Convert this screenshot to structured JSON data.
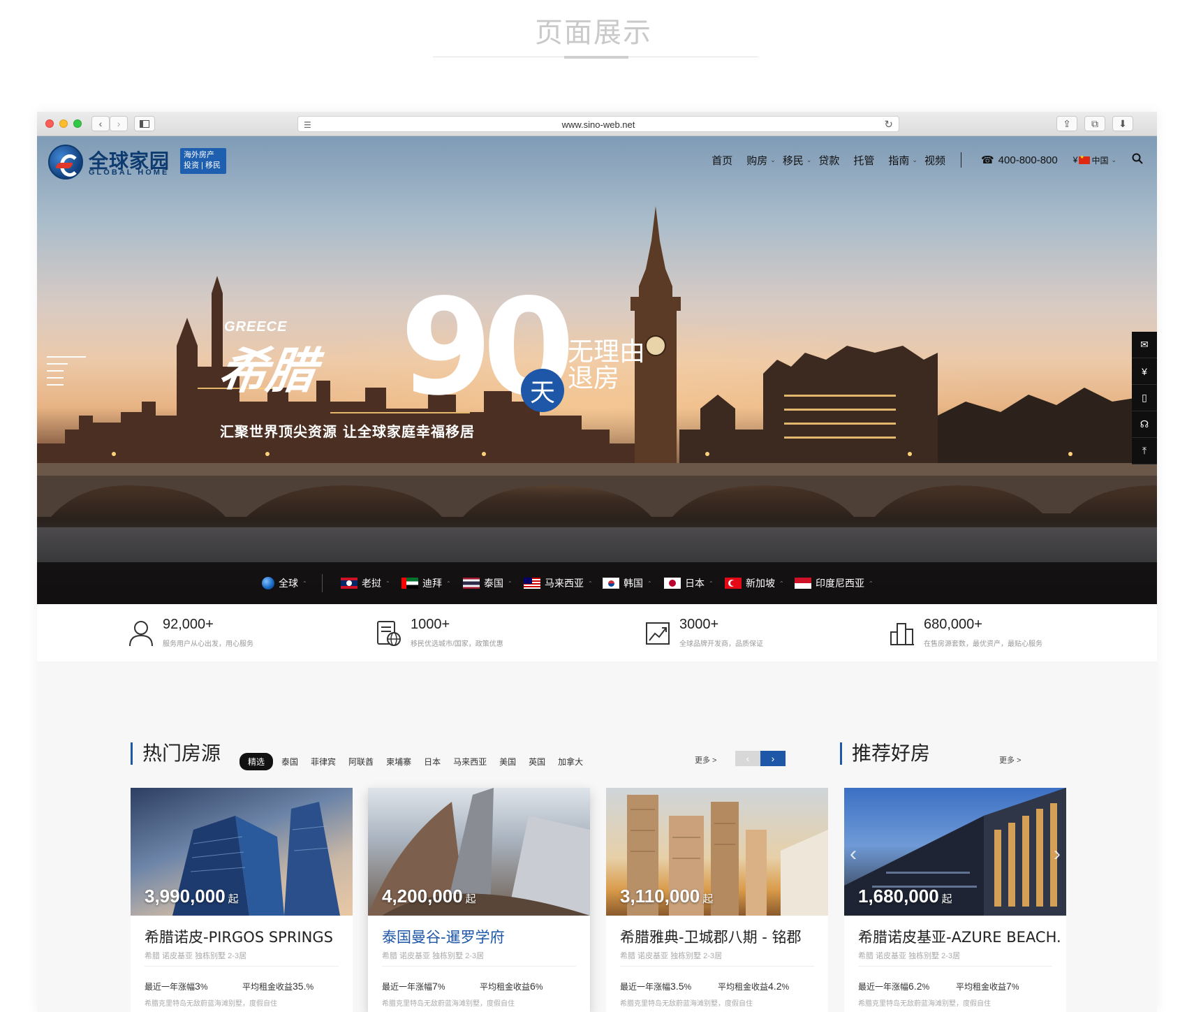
{
  "showcase": {
    "title": "页面展示"
  },
  "browser": {
    "url": "www.sino-web.net"
  },
  "logo": {
    "name_cn": "全球家园",
    "name_en": "GLOBAL HOME",
    "badge_line1": "海外房产",
    "badge_line2": "投资 | 移民"
  },
  "nav": {
    "items": [
      {
        "label": "首页",
        "dropdown": false
      },
      {
        "label": "购房",
        "dropdown": true
      },
      {
        "label": "移民",
        "dropdown": true
      },
      {
        "label": "贷款",
        "dropdown": false
      },
      {
        "label": "托管",
        "dropdown": false
      },
      {
        "label": "指南",
        "dropdown": true
      },
      {
        "label": "视频",
        "dropdown": false
      }
    ],
    "phone": "400-800-800",
    "currency": "¥",
    "region": "中国"
  },
  "promo": {
    "country_en": "GREECE",
    "country_cn": "希腊",
    "number": "90",
    "unit": "天",
    "line1": "无理由",
    "line2": "退房",
    "slogan": "汇聚世界顶尖资源  让全球家庭幸福移居"
  },
  "side_tools": [
    "wechat-icon",
    "yen-icon",
    "mobile-icon",
    "headset-icon",
    "top-icon"
  ],
  "countries": [
    {
      "label": "全球",
      "flag": "globe"
    },
    {
      "label": "老挝",
      "flag": "laos"
    },
    {
      "label": "迪拜",
      "flag": "uae"
    },
    {
      "label": "泰国",
      "flag": "thailand"
    },
    {
      "label": "马来西亚",
      "flag": "malaysia"
    },
    {
      "label": "韩国",
      "flag": "korea"
    },
    {
      "label": "日本",
      "flag": "japan"
    },
    {
      "label": "新加坡",
      "flag": "turkey-style"
    },
    {
      "label": "印度尼西亚",
      "flag": "indonesia"
    }
  ],
  "stats": [
    {
      "value": "92,000+",
      "desc": "服务用户从心出发，用心服务",
      "icon": "user-icon"
    },
    {
      "value": "1000+",
      "desc": "移民优选城市/国家，政策优惠",
      "icon": "document-globe-icon"
    },
    {
      "value": "3000+",
      "desc": "全球品牌开发商，品质保证",
      "icon": "trend-chart-icon"
    },
    {
      "value": "680,000+",
      "desc": "在售房源套数，最优资产，最贴心服务",
      "icon": "buildings-icon"
    }
  ],
  "hot": {
    "title": "热门房源",
    "tabs": [
      "精选",
      "泰国",
      "菲律宾",
      "阿联酋",
      "柬埔寨",
      "日本",
      "马来西亚",
      "美国",
      "英国",
      "加拿大"
    ],
    "more": "更多 >"
  },
  "recommend": {
    "title": "推荐好房",
    "more": "更多 >"
  },
  "cards": [
    {
      "price": "3,990,000",
      "unit": "起",
      "title": "希腊诺皮-PIRGOS SPRINGS",
      "sub": "希腊 诺皮基亚 独栋别墅 2-3居",
      "growth_label": "最近一年涨幅",
      "growth": "3",
      "rent_label": "平均租金收益",
      "rent": "35.",
      "foot": "希腊克里特岛无敌蔚蓝海滩别墅，度假自住"
    },
    {
      "price": "4,200,000",
      "unit": "起",
      "title": "泰国曼谷-暹罗学府",
      "sub": "希腊 诺皮基亚 独栋别墅 2-3居",
      "growth_label": "最近一年涨幅",
      "growth": "7",
      "rent_label": "平均租金收益",
      "rent": "6",
      "foot": "希腊克里特岛无敌蔚蓝海滩别墅，度假自住"
    },
    {
      "price": "3,110,000",
      "unit": "起",
      "title": "希腊雅典-卫城郡八期 - 铭郡",
      "sub": "希腊 诺皮基亚 独栋别墅 2-3居",
      "growth_label": "最近一年涨幅",
      "growth": "3.5",
      "rent_label": "平均租金收益",
      "rent": "4.2",
      "foot": "希腊克里特岛无敌蔚蓝海滩别墅，度假自住"
    },
    {
      "price": "1,680,000",
      "unit": "起",
      "title": "希腊诺皮基亚-AZURE BEACH...",
      "sub": "希腊 诺皮基亚 独栋别墅 2-3居",
      "growth_label": "最近一年涨幅",
      "growth": "6.2",
      "rent_label": "平均租金收益",
      "rent": "7",
      "foot": "希腊克里特岛无敌蔚蓝海滩别墅，度假自住"
    }
  ],
  "percent": "%",
  "colors": {
    "brand_blue": "#1e57a8",
    "logo_navy": "#0d3a6f",
    "accent_red": "#e0392c"
  }
}
